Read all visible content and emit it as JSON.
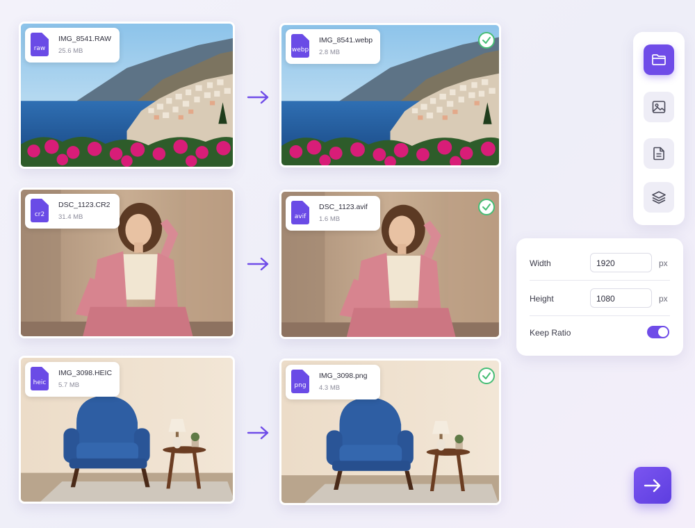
{
  "conversions": [
    {
      "source": {
        "format": "raw",
        "filename": "IMG_8541.RAW",
        "size": "25.6 MB"
      },
      "output": {
        "format": "webp",
        "filename": "IMG_8541.webp",
        "size": "2.8 MB"
      },
      "status": "check-circle-icon",
      "scene": "coastal-village"
    },
    {
      "source": {
        "format": "cr2",
        "filename": "DSC_1123.CR2",
        "size": "31.4 MB"
      },
      "output": {
        "format": "avif",
        "filename": "DSC_1123.avif",
        "size": "1.6 MB"
      },
      "status": "check-circle-icon",
      "scene": "portrait-pink-suit"
    },
    {
      "source": {
        "format": "heic",
        "filename": "IMG_3098.HEIC",
        "size": "5.7 MB"
      },
      "output": {
        "format": "png",
        "filename": "IMG_3098.png",
        "size": "4.3 MB"
      },
      "status": "check-circle-icon",
      "scene": "blue-armchair-room"
    }
  ],
  "toolbar": {
    "buttons": [
      {
        "icon": "folder-icon",
        "active": true
      },
      {
        "icon": "image-icon",
        "active": false
      },
      {
        "icon": "document-icon",
        "active": false
      },
      {
        "icon": "layers-icon",
        "active": false
      }
    ]
  },
  "resize_panel": {
    "width_label": "Width",
    "width_value": "1920",
    "width_unit": "px",
    "height_label": "Height",
    "height_value": "1080",
    "height_unit": "px",
    "keep_ratio_label": "Keep Ratio",
    "keep_ratio_on": true
  },
  "colors": {
    "accent": "#6f4ce8",
    "success": "#46bd75",
    "panel_bg": "#ffffff",
    "page_bg": "#f1f0f8"
  },
  "actions": {
    "convert_icon": "arrow-right-icon"
  }
}
